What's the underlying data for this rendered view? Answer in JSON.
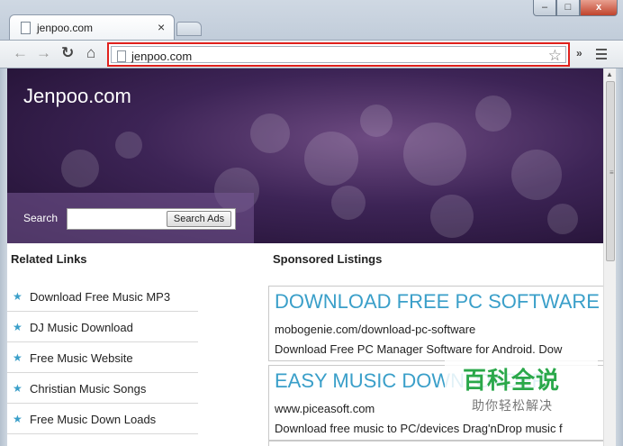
{
  "browser": {
    "tab_title": "jenpoo.com",
    "tab_close": "×",
    "url": "jenpoo.com",
    "overflow_label": "»",
    "window_buttons": {
      "minimize": "–",
      "maximize": "□",
      "close": "x"
    }
  },
  "site": {
    "title": "Jenpoo.com",
    "search_label": "Search",
    "search_placeholder": "",
    "search_button": "Search Ads"
  },
  "related": {
    "title": "Related Links",
    "items": [
      {
        "label": "Download Free Music MP3"
      },
      {
        "label": "DJ Music Download"
      },
      {
        "label": "Free Music Website"
      },
      {
        "label": "Christian Music Songs"
      },
      {
        "label": "Free Music Down Loads"
      }
    ]
  },
  "sponsored": {
    "title": "Sponsored Listings",
    "listings": [
      {
        "head": "DOWNLOAD FREE PC SOFTWARE",
        "url": "mobogenie.com/download-pc-software",
        "desc": "Download Free PC Manager Software for Android. Dow"
      },
      {
        "head": "EASY MUSIC DOWNLOADER",
        "url": "www.piceasoft.com",
        "desc": "Download free music to PC/devices Drag'nDrop music f"
      }
    ]
  },
  "watermark": {
    "main": "百科全说",
    "sub": "助你轻松解决"
  },
  "colors": {
    "accent_link": "#3a9fc9",
    "highlight_border": "#e0211d",
    "watermark_green": "#2aa84a"
  },
  "icons": [
    "page-icon",
    "close-icon",
    "back-arrow-icon",
    "forward-arrow-icon",
    "reload-icon",
    "home-icon",
    "bookmark-star-icon",
    "menu-icon",
    "star-bullet-icon"
  ]
}
